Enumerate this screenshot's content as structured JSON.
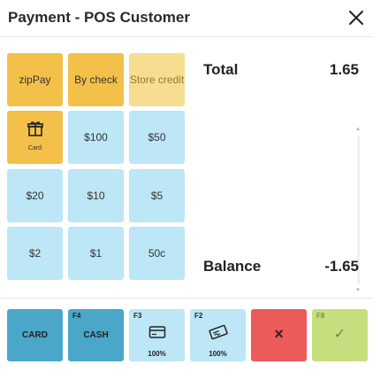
{
  "header": {
    "title": "Payment - POS Customer",
    "close_icon": "close-icon"
  },
  "tiles": {
    "zippay": "zipPay",
    "by_check": "By check",
    "store_credit": "Store credit",
    "card_label": "Card",
    "d100": "$100",
    "d50": "$50",
    "d20": "$20",
    "d10": "$10",
    "d5": "$5",
    "d2": "$2",
    "d1": "$1",
    "c50": "50c"
  },
  "summary": {
    "total_label": "Total",
    "total_value": "1.65",
    "balance_label": "Balance",
    "balance_value": "-1.65"
  },
  "footer": {
    "card_label": "CARD",
    "cash_key": "F4",
    "cash_label": "CASH",
    "f3_key": "F3",
    "f3_pct": "100%",
    "f2_key": "F2",
    "f2_pct": "100%",
    "cancel_symbol": "×",
    "f8_key": "F8",
    "confirm_symbol": "✓"
  },
  "colors": {
    "yellow": "#f3c149",
    "yellow_light": "#f6dd8f",
    "blue_light": "#bde6f6",
    "blue_dark": "#4aa7c9",
    "red": "#ec5a5a",
    "green": "#c6df7e"
  }
}
